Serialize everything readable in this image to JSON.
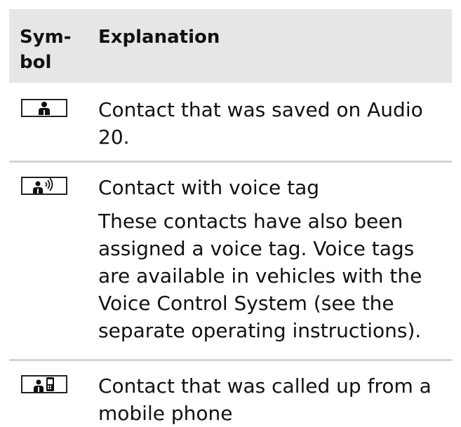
{
  "table": {
    "header": {
      "symbol_label_line1": "Sym-",
      "symbol_label_line2": "bol",
      "explanation_label": "Explanation"
    },
    "rows": [
      {
        "icon": "contact-person-icon",
        "text": "Contact that was saved on Audio 20."
      },
      {
        "icon": "contact-voice-tag-icon",
        "title": "Contact with voice tag",
        "text": "These contacts have also been assigned a voice tag. Voice tags are available in vehicles with the Voice Control System (see the separate operating instructions)."
      },
      {
        "icon": "contact-mobile-phone-icon",
        "text": "Contact that was called up from a mobile phone"
      }
    ]
  }
}
